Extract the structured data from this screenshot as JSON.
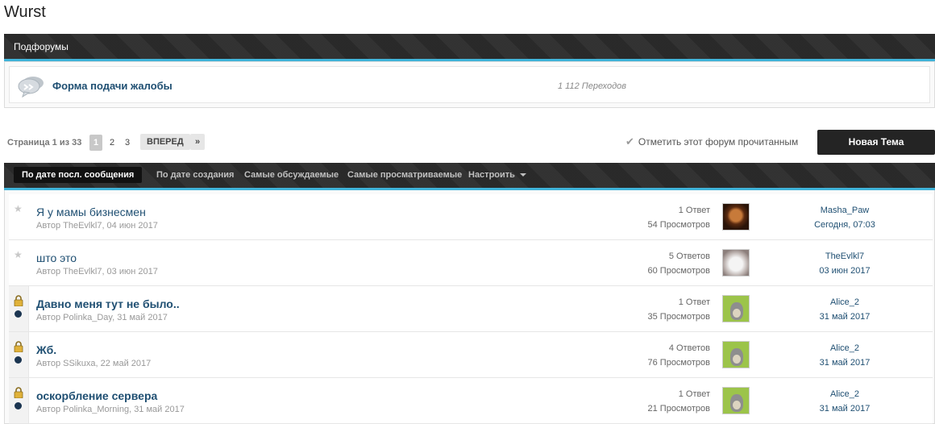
{
  "page": {
    "title": "Wurst"
  },
  "subforums": {
    "header": "Подфорумы",
    "items": [
      {
        "name": "Форма подачи жалобы",
        "stats": "1 112 Переходов"
      }
    ]
  },
  "pagination": {
    "label": "Страница 1 из 33",
    "pages": [
      "1",
      "2",
      "3"
    ],
    "current": "1",
    "next_label": "ВПЕРЕД",
    "last_label": "»"
  },
  "actions": {
    "mark_read": "Отметить этот форум прочитанным",
    "new_topic": "Новая Тема"
  },
  "sort_tabs": [
    {
      "label": "По дате посл. сообщения",
      "active": true
    },
    {
      "label": "По дате создания",
      "active": false
    },
    {
      "label": "Самые обсуждаемые",
      "active": false
    },
    {
      "label": "Самые просматриваемые",
      "active": false
    },
    {
      "label": "Настроить",
      "active": false,
      "dropdown": true
    }
  ],
  "topics": [
    {
      "title": "Я у мамы бизнесмен",
      "meta": "Автор TheEvlkl7, 04 июн 2017",
      "replies": "1 Ответ",
      "views": "54 Просмотров",
      "last_user": "Masha_Paw",
      "last_date": "Сегодня, 07:03",
      "locked": false,
      "avatar": "dark-photo"
    },
    {
      "title": "што это",
      "meta": "Автор TheEvlkl7, 03 июн 2017",
      "replies": "5 Ответов",
      "views": "60 Просмотров",
      "last_user": "TheEvlkl7",
      "last_date": "03 июн 2017",
      "locked": false,
      "avatar": "white-cat-photo"
    },
    {
      "title": "Давно меня тут не было..",
      "meta": "Автор Polinka_Day, 31 май 2017",
      "replies": "1 Ответ",
      "views": "35 Просмотров",
      "last_user": "Alice_2",
      "last_date": "31 май 2017",
      "locked": true,
      "avatar": "totoro"
    },
    {
      "title": "Жб.",
      "meta": "Автор SSikuxa, 22 май 2017",
      "replies": "4 Ответов",
      "views": "76 Просмотров",
      "last_user": "Alice_2",
      "last_date": "31 май 2017",
      "locked": true,
      "avatar": "totoro"
    },
    {
      "title": "оскорбление сервера",
      "meta": "Автор Polinka_Morning, 31 май 2017",
      "replies": "1 Ответ",
      "views": "21 Просмотров",
      "last_user": "Alice_2",
      "last_date": "31 май 2017",
      "locked": true,
      "avatar": "totoro"
    }
  ],
  "colors": {
    "accent": "#3fb3d9",
    "link": "#1f4f72",
    "bar": "#2c2c2c"
  }
}
